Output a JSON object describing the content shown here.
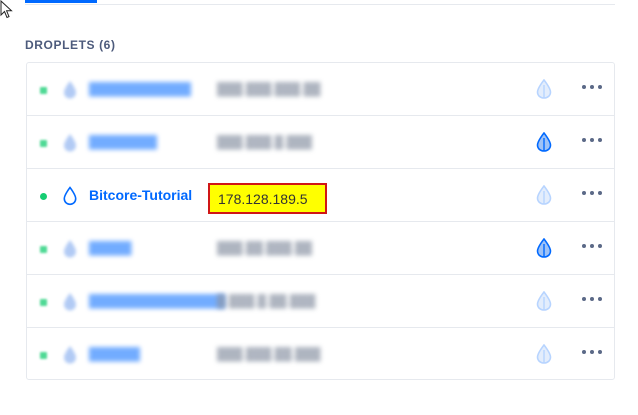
{
  "section": {
    "title": "DROPLETS (6)"
  },
  "colors": {
    "accent": "#0069ff",
    "status_on": "#15cd72",
    "highlight_fill": "#ffff00",
    "highlight_border": "#d01616"
  },
  "droplets": [
    {
      "name": "",
      "ip": "",
      "backup_active": false,
      "blurred": true
    },
    {
      "name": "",
      "ip": "",
      "backup_active": true,
      "blurred": true
    },
    {
      "name": "Bitcore-Tutorial",
      "ip": "178.128.189.5",
      "backup_active": false,
      "blurred": false
    },
    {
      "name": "",
      "ip": "",
      "backup_active": true,
      "blurred": true
    },
    {
      "name": "",
      "ip": "",
      "backup_active": false,
      "blurred": true
    },
    {
      "name": "",
      "ip": "",
      "backup_active": false,
      "blurred": true
    }
  ],
  "icons": {
    "droplet": "droplet-icon",
    "backup": "backup-droplet-icon",
    "more": "more-options-icon",
    "cursor": "mouse-pointer-icon"
  }
}
